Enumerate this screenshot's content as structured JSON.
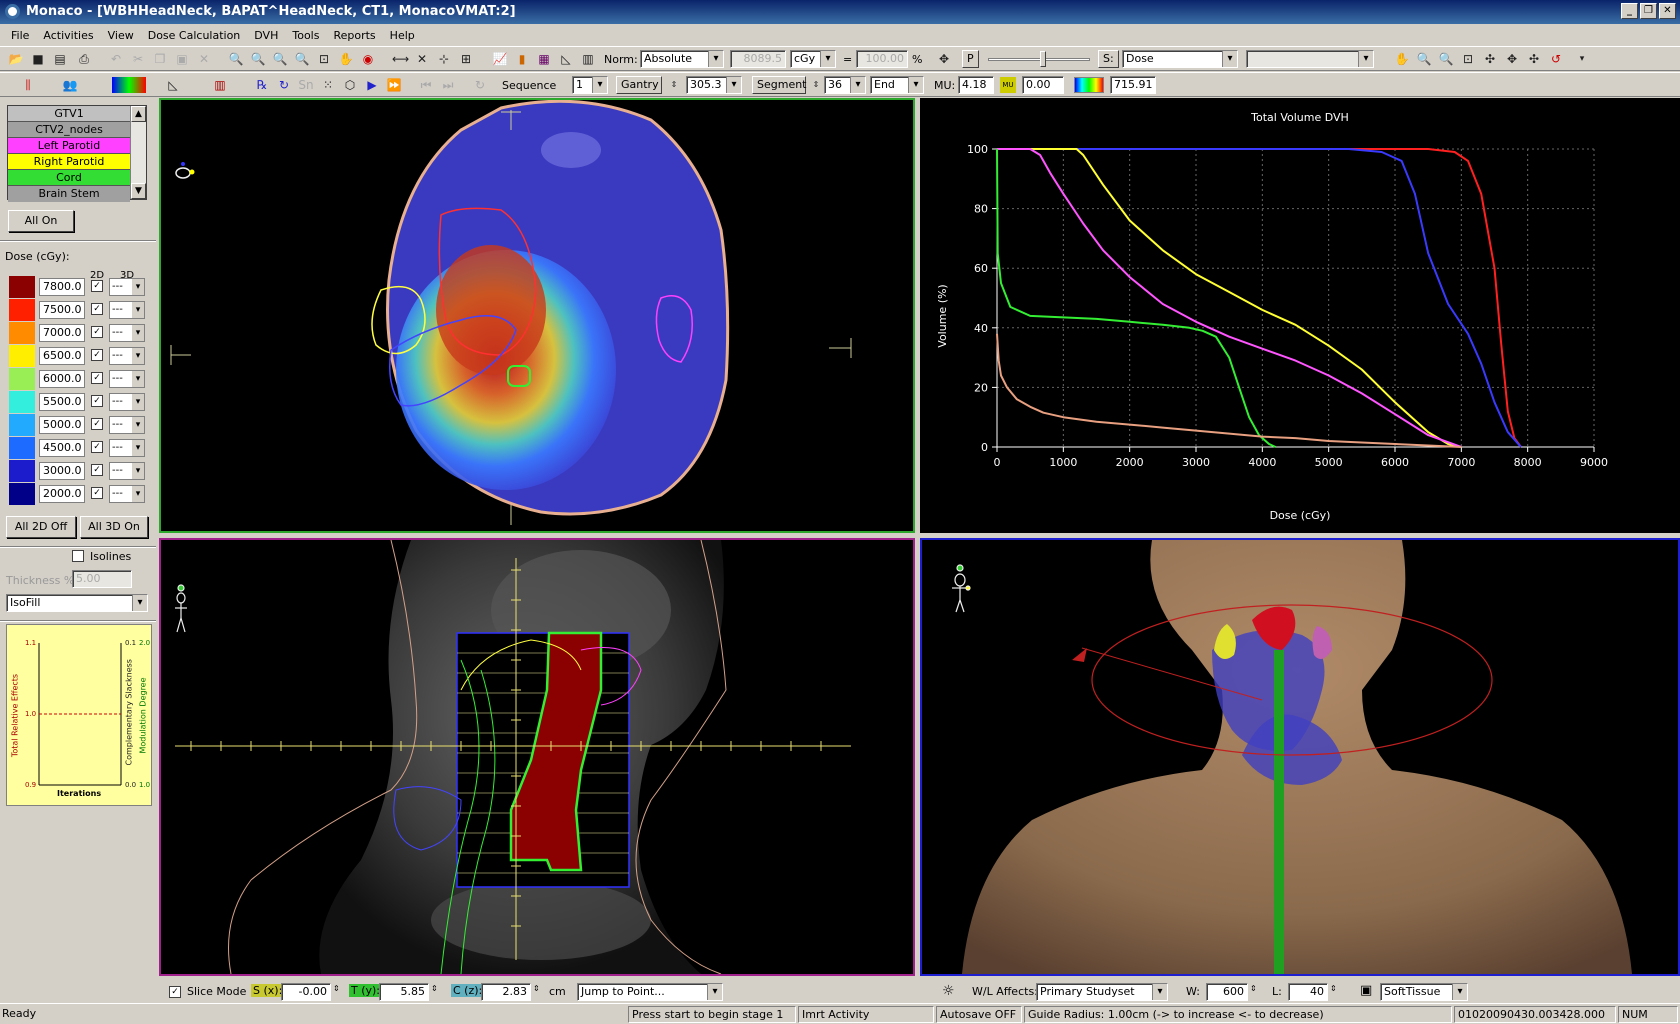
{
  "window": {
    "title": "Monaco - [WBHHeadNeck, BAPAT^HeadNeck, CT1, MonacoVMAT:2]"
  },
  "menu": [
    "File",
    "Activities",
    "View",
    "Dose Calculation",
    "DVH",
    "Tools",
    "Reports",
    "Help"
  ],
  "toolbar1": {
    "norm_label": "Norm:",
    "norm_value": "Absolute",
    "dose_value": "8089.5",
    "unit": "cGy",
    "equals": "=",
    "percent_value": "100.00",
    "percent_sign": "%",
    "p_label": "P",
    "s_label": "S:",
    "s_value": "Dose"
  },
  "toolbar2": {
    "sequence_label": "Sequence",
    "sequence_value": "1",
    "gantry_label": "Gantry",
    "gantry_value": "305.3",
    "segment_label": "Segment",
    "segment_value": "36",
    "end_value": "End",
    "mu_label": "MU:",
    "mu_value": "4.18",
    "mu_icon_text": "MU",
    "mu2_value": "0.00",
    "cmap_value": "715.91"
  },
  "structures": [
    {
      "name": "GTV1",
      "color": "#c0c0c0"
    },
    {
      "name": "CTV2_nodes",
      "color": "#a0a0a0"
    },
    {
      "name": "Left Parotid",
      "color": "#ff40ff"
    },
    {
      "name": "Right Parotid",
      "color": "#ffff00"
    },
    {
      "name": "Cord",
      "color": "#33dd33"
    },
    {
      "name": "Brain Stem",
      "color": "#a0a0a0"
    }
  ],
  "left": {
    "all_on": "All On",
    "dose_label": "Dose (cGy):",
    "col_2d": "2D",
    "col_3d": "3D",
    "all2d_off": "All 2D Off",
    "all3d_on": "All 3D On",
    "isolines": "Isolines",
    "thickness_label": "Thickness %",
    "thickness_value": "5.00",
    "fill_mode": "IsoFill"
  },
  "dose_levels": [
    {
      "value": "7800.0",
      "color": "#8b0000"
    },
    {
      "value": "7500.0",
      "color": "#ff2000"
    },
    {
      "value": "7000.0",
      "color": "#ff8c00"
    },
    {
      "value": "6500.0",
      "color": "#ffee00"
    },
    {
      "value": "6000.0",
      "color": "#99ee55"
    },
    {
      "value": "5500.0",
      "color": "#33eedd"
    },
    {
      "value": "5000.0",
      "color": "#22aaff"
    },
    {
      "value": "4500.0",
      "color": "#1e6cff"
    },
    {
      "value": "3000.0",
      "color": "#1c1ccc"
    },
    {
      "value": "2000.0",
      "color": "#000088"
    }
  ],
  "line_style": "---",
  "opt_chart": {
    "y_left_top": "1.1",
    "y_left_mid": "1.0",
    "y_left_bot": "0.9",
    "y_right1_top": "0.1",
    "y_right1_bot": "0.0",
    "y_right2_top": "2.0",
    "y_right2_bot": "1.0",
    "left_label": "Total Relative Effects",
    "right1_label": "Complementary Slackness",
    "right2_label": "Modulation Degree",
    "x_label": "Iterations"
  },
  "chart_data": {
    "type": "line",
    "title": "Total Volume DVH",
    "xlabel": "Dose (cGy)",
    "ylabel": "Volume (%)",
    "xlim": [
      0,
      9000
    ],
    "ylim": [
      0,
      100
    ],
    "xticks": [
      0,
      1000,
      2000,
      3000,
      4000,
      5000,
      6000,
      7000,
      8000,
      9000
    ],
    "yticks": [
      0,
      20,
      40,
      60,
      80,
      100
    ],
    "grid": true,
    "series": [
      {
        "color": "#ff2020",
        "x": [
          0,
          6000,
          6500,
          6900,
          7100,
          7300,
          7500,
          7600,
          7700,
          7800,
          7900
        ],
        "y": [
          100,
          100,
          100,
          99,
          96,
          85,
          60,
          35,
          12,
          3,
          0
        ]
      },
      {
        "color": "#3a3aff",
        "x": [
          0,
          5300,
          5800,
          6100,
          6300,
          6500,
          6800,
          7100,
          7300,
          7500,
          7700,
          7900
        ],
        "y": [
          100,
          100,
          99,
          96,
          85,
          65,
          48,
          38,
          28,
          15,
          5,
          0
        ]
      },
      {
        "color": "#ffff33",
        "x": [
          0,
          1200,
          1300,
          1600,
          2000,
          2500,
          3000,
          3500,
          4000,
          4500,
          5000,
          5500,
          6000,
          6500,
          6800,
          7000
        ],
        "y": [
          100,
          100,
          98,
          88,
          76,
          66,
          58,
          52,
          46,
          41,
          34,
          26,
          15,
          5,
          1,
          0
        ]
      },
      {
        "color": "#ff55ff",
        "x": [
          0,
          500,
          650,
          800,
          1000,
          1300,
          1600,
          2000,
          2500,
          3000,
          3500,
          4000,
          4500,
          5000,
          5500,
          6000,
          6500,
          7000
        ],
        "y": [
          100,
          100,
          98,
          92,
          85,
          75,
          66,
          57,
          48,
          42,
          37,
          33,
          29,
          24,
          18,
          11,
          4,
          0
        ]
      },
      {
        "color": "#33ee33",
        "x": [
          0,
          10,
          60,
          200,
          500,
          1000,
          1500,
          2000,
          2500,
          2900,
          3100,
          3300,
          3500,
          3650,
          3800,
          3950,
          4100,
          4200
        ],
        "y": [
          100,
          65,
          55,
          47,
          44,
          43.5,
          43,
          42,
          41,
          40,
          39,
          37,
          30,
          20,
          10,
          4,
          1,
          0
        ]
      },
      {
        "color": "#e8a080",
        "x": [
          0,
          25,
          60,
          150,
          300,
          500,
          700,
          1000,
          1500,
          2000,
          2500,
          3000,
          3500,
          4000,
          4500,
          5000,
          5500,
          6000,
          6500,
          7000
        ],
        "y": [
          38,
          29,
          24,
          20,
          16,
          13.5,
          11.5,
          10,
          8.5,
          7.5,
          6.5,
          5.5,
          4.5,
          3.5,
          3,
          2,
          1.5,
          1,
          0.5,
          0
        ]
      }
    ]
  },
  "bottom": {
    "slice_mode": "Slice Mode",
    "s_label": "S (x):",
    "s_value": "-0.00",
    "t_label": "T (y):",
    "t_value": "5.85",
    "c_label": "C (z):",
    "c_value": "2.83",
    "unit": "cm",
    "jump": "Jump to Point...",
    "wl_label": "W/L Affects:",
    "wl_value": "Primary Studyset",
    "w_label": "W:",
    "w_value": "600",
    "l_label": "L:",
    "l_value": "40",
    "preset": "SoftTissue"
  },
  "status": {
    "ready": "Ready",
    "press": "Press start to begin stage 1",
    "imrt": "Imrt Activity",
    "autosave": "Autosave OFF",
    "guide": "Guide Radius: 1.00cm (-> to increase <- to decrease)",
    "id": "01020090430.003428.000",
    "num": "NUM"
  }
}
